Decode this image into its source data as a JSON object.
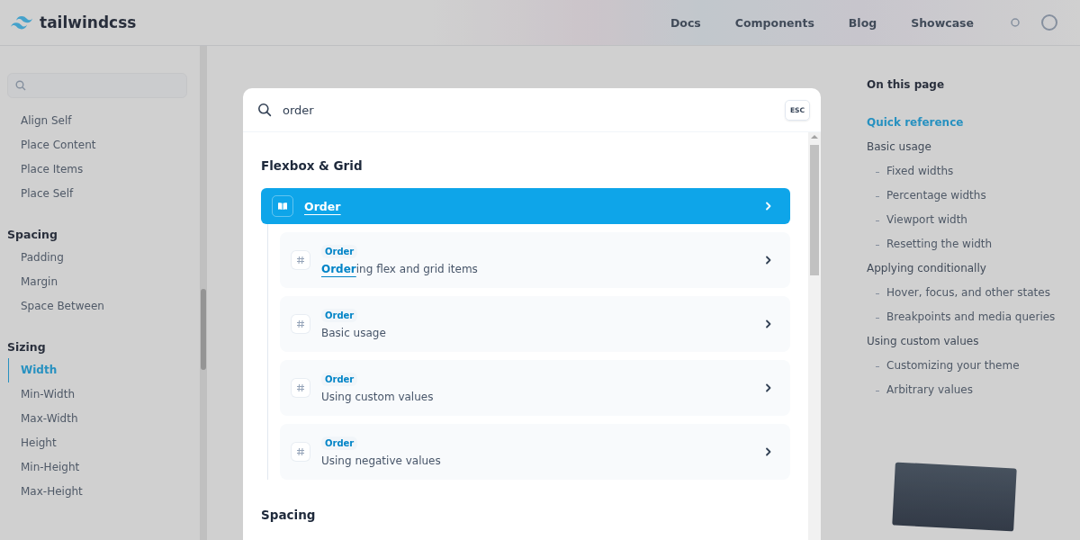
{
  "header": {
    "logo": "tailwindcss",
    "nav": [
      "Docs",
      "Components",
      "Blog",
      "Showcase"
    ]
  },
  "sidebar": {
    "groups": [
      {
        "items": [
          {
            "label": "Align Self",
            "selected": false
          },
          {
            "label": "Place Content",
            "selected": false
          },
          {
            "label": "Place Items",
            "selected": false
          },
          {
            "label": "Place Self",
            "selected": false
          }
        ]
      },
      {
        "heading": "Spacing",
        "items": [
          {
            "label": "Padding",
            "selected": false
          },
          {
            "label": "Margin",
            "selected": false
          },
          {
            "label": "Space Between",
            "selected": false
          }
        ]
      },
      {
        "heading": "Sizing",
        "items": [
          {
            "label": "Width",
            "selected": true
          },
          {
            "label": "Min-Width",
            "selected": false
          },
          {
            "label": "Max-Width",
            "selected": false
          },
          {
            "label": "Height",
            "selected": false
          },
          {
            "label": "Min-Height",
            "selected": false
          },
          {
            "label": "Max-Height",
            "selected": false
          }
        ]
      }
    ]
  },
  "toc": {
    "title": "On this page",
    "items": [
      {
        "label": "Quick reference",
        "selected": true
      },
      {
        "label": "Basic usage",
        "selected": false,
        "children": [
          {
            "label": "Fixed widths",
            "selected": false
          },
          {
            "label": "Percentage widths",
            "selected": false
          },
          {
            "label": "Viewport width",
            "selected": false
          },
          {
            "label": "Resetting the width",
            "selected": false
          }
        ]
      },
      {
        "label": "Applying conditionally",
        "selected": false,
        "children": [
          {
            "label": "Hover, focus, and other states",
            "selected": false
          },
          {
            "label": "Breakpoints and media queries",
            "selected": false
          }
        ]
      },
      {
        "label": "Using custom values",
        "selected": false,
        "children": [
          {
            "label": "Customizing your theme",
            "selected": false
          },
          {
            "label": "Arbitrary values",
            "selected": false
          }
        ]
      }
    ]
  },
  "search": {
    "value": "order",
    "esc": "ESC",
    "groups": [
      {
        "heading": "Flexbox & Grid",
        "results": [
          {
            "kind": "page",
            "match": "Order",
            "selected": true,
            "children": [
              {
                "kind": "section",
                "badge": "Order",
                "match": "Order",
                "rest": "ing flex and grid items",
                "selected": false
              },
              {
                "kind": "section",
                "badge": "Order",
                "rest": "Basic usage",
                "selected": false
              },
              {
                "kind": "section",
                "badge": "Order",
                "rest": "Using custom values",
                "selected": false
              },
              {
                "kind": "section",
                "badge": "Order",
                "rest": "Using negative values",
                "selected": false
              }
            ]
          }
        ]
      },
      {
        "heading": "Spacing"
      }
    ]
  }
}
